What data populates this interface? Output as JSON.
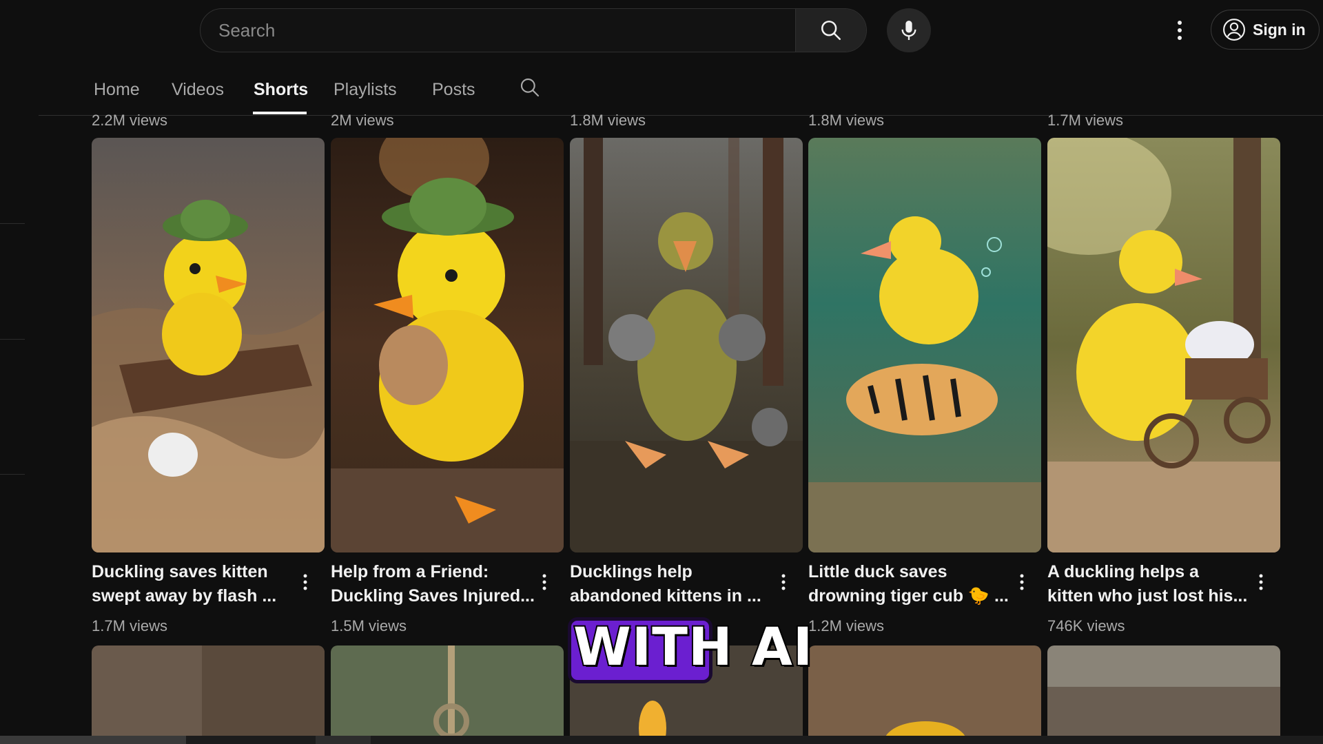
{
  "header": {
    "search_placeholder": "Search",
    "icons": [
      "search-icon",
      "mic-icon",
      "more-vert-icon",
      "account-icon"
    ],
    "signin_label": "Sign in"
  },
  "tabs": [
    {
      "label": "Home",
      "active": false
    },
    {
      "label": "Videos",
      "active": false
    },
    {
      "label": "Shorts",
      "active": true
    },
    {
      "label": "Playlists",
      "active": false
    },
    {
      "label": "Posts",
      "active": false
    }
  ],
  "previous_row": [
    {
      "views": "2.2M views"
    },
    {
      "views": "2M views"
    },
    {
      "views": "1.8M views"
    },
    {
      "views": "1.8M views"
    },
    {
      "views": "1.7M views"
    }
  ],
  "shorts": [
    {
      "title_line1": "Duckling saves kitten",
      "title_line2": "swept away by flash ...",
      "views": "1.7M views"
    },
    {
      "title_line1": "Help from a Friend:",
      "title_line2": "Duckling Saves Injured...",
      "views": "1.5M views"
    },
    {
      "title_line1": "Ducklings help",
      "title_line2": "abandoned kittens in ...",
      "views": ""
    },
    {
      "title_line1": "Little duck saves",
      "title_line2": "drowning tiger cub 🐤 ...",
      "views": "1.2M views"
    },
    {
      "title_line1": "A duckling helps a",
      "title_line2": "kitten who just lost his...",
      "views": "746K views"
    }
  ],
  "overlay_caption": "WITH AI",
  "colors": {
    "background": "#0f0f0f",
    "text_primary": "#f1f1f1",
    "text_secondary": "#aaaaaa",
    "overlay_accent": "#6b1fd0"
  }
}
